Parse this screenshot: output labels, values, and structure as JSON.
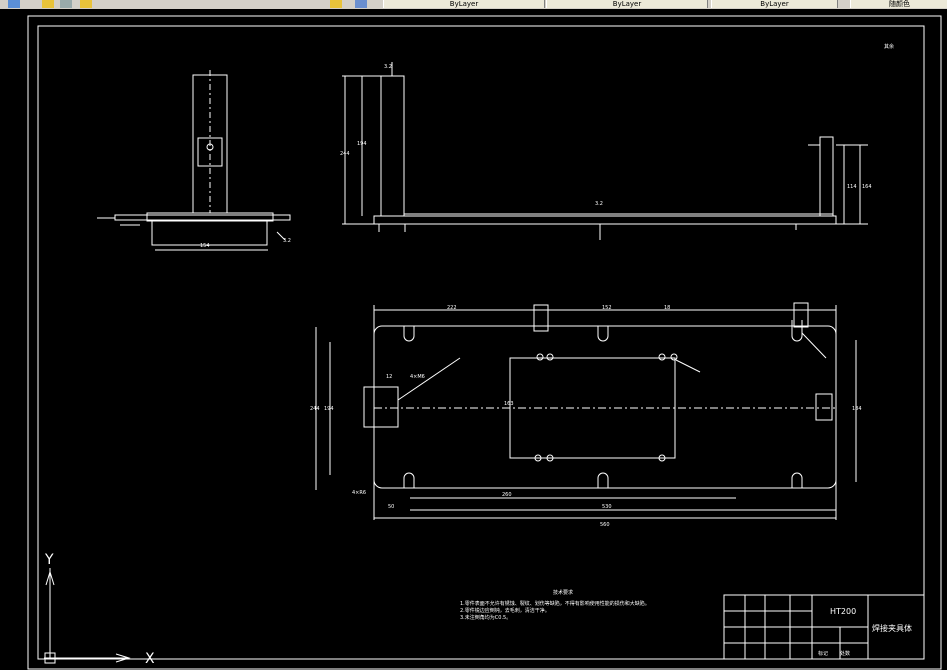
{
  "toolbar": {
    "tabs": [
      {
        "label": "ByLayer"
      },
      {
        "label": "ByLayer"
      },
      {
        "label": "ByLayer"
      },
      {
        "label": "随颜色"
      }
    ]
  },
  "drawing": {
    "roughness": "其余",
    "side_view": {
      "dim_width": "154",
      "dim_roughness": "3.2"
    },
    "front_view": {
      "dim_height_outer": "244",
      "dim_height_inner": "194",
      "dim_right_outer": "164",
      "dim_right_inner": "114",
      "dim_roughness_top": "3.2",
      "dim_roughness_base": "3.2"
    },
    "plan_view": {
      "dims_top": [
        "222",
        "152",
        "18"
      ],
      "dim_left_outer": "244",
      "dim_left_inner": "194",
      "dim_center": "163",
      "dim_right": "184",
      "dim_thread": "4×M6",
      "dim_slot": "12",
      "dim_bottom_inner": "260",
      "dim_bottom_mid": "530",
      "dim_bottom_total": "560",
      "dim_bottom_left": "50",
      "dim_chamfer": "4×R6"
    },
    "notes": {
      "title": "技术要求",
      "lines": [
        "1.零件表面不允许有锈蚀、裂纹、划伤等缺陷，不得有影响使用性能的损伤和大缺陷。",
        "2.零件锐边应倒钝，去毛刺，清洁干净。",
        "3.未注倒角均为C0.5。"
      ]
    },
    "title_block": {
      "part_code": "HT200",
      "part_name": "焊接夹具体",
      "row_labels": [
        "标记",
        "处数"
      ]
    },
    "ucs": {
      "x_label": "X",
      "y_label": "Y"
    }
  }
}
